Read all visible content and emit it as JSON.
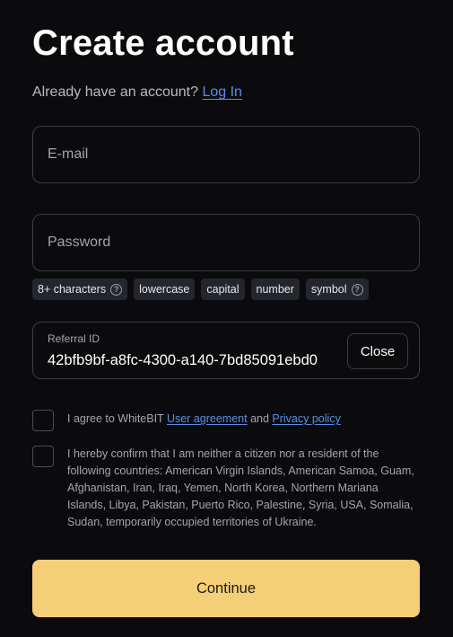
{
  "header": {
    "title": "Create account",
    "have_account_text": "Already have an account?",
    "login_link": "Log In"
  },
  "form": {
    "email_placeholder": "E-mail",
    "password_placeholder": "Password",
    "password_requirements": [
      "8+ characters",
      "lowercase",
      "capital",
      "number",
      "symbol"
    ],
    "referral": {
      "label": "Referral ID",
      "value": "42bfb9bf-a8fc-4300-a140-7bd85091ebd0",
      "close_label": "Close"
    },
    "agreement": {
      "prefix": "I agree to WhiteBIT",
      "user_agreement_link": "User agreement",
      "and": "and",
      "privacy_link": "Privacy policy"
    },
    "confirmation_text": "I hereby confirm that I am neither a citizen nor a resident of the following countries: American Virgin Islands, American Samoa, Guam, Afghanistan, Iran, Iraq, Yemen, North Korea, Northern Mariana Islands, Libya, Pakistan, Puerto Rico, Palestine, Syria, USA, Somalia, Sudan, temporarily occupied territories of Ukraine.",
    "continue_label": "Continue"
  },
  "icons": {
    "help": "question-circle-icon"
  },
  "colors": {
    "background": "#0b0b0e",
    "accent_button": "#f5cf77",
    "link": "#5a8ee8",
    "border": "#3b3d45"
  }
}
